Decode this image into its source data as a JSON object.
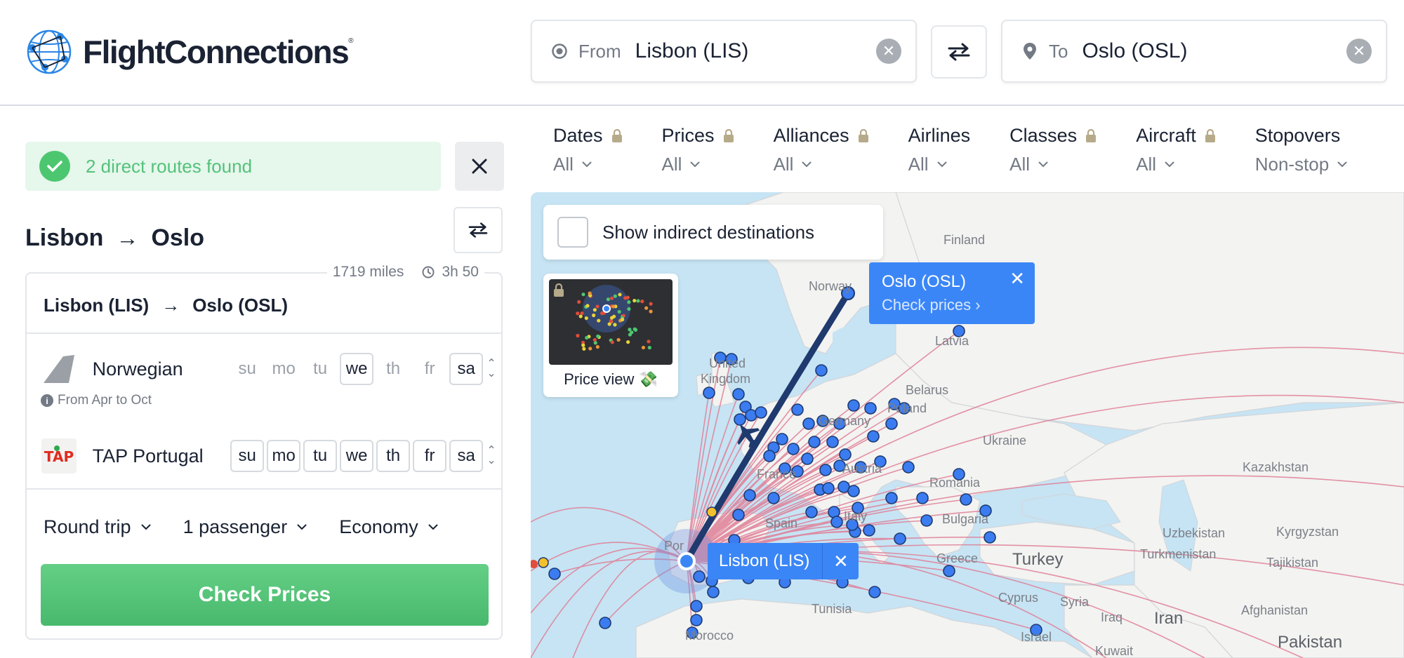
{
  "brand": {
    "name": "FlightConnections",
    "mark": "®"
  },
  "search": {
    "from_label": "From",
    "from_value": "Lisbon (LIS)",
    "to_label": "To",
    "to_value": "Oslo (OSL)"
  },
  "status": {
    "text": "2 direct routes found"
  },
  "route": {
    "from": "Lisbon",
    "to": "Oslo",
    "arrow": "→"
  },
  "card": {
    "distance": "1719 miles",
    "duration": "3h 50",
    "from": "Lisbon (LIS)",
    "to": "Oslo (OSL)",
    "airlines": [
      {
        "name": "Norwegian",
        "note": "From Apr to Oct",
        "days": [
          {
            "d": "su",
            "on": false
          },
          {
            "d": "mo",
            "on": false
          },
          {
            "d": "tu",
            "on": false
          },
          {
            "d": "we",
            "on": true
          },
          {
            "d": "th",
            "on": false
          },
          {
            "d": "fr",
            "on": false
          },
          {
            "d": "sa",
            "on": true
          }
        ]
      },
      {
        "name": "TAP Portugal",
        "days": [
          {
            "d": "su",
            "on": true
          },
          {
            "d": "mo",
            "on": true
          },
          {
            "d": "tu",
            "on": true
          },
          {
            "d": "we",
            "on": true
          },
          {
            "d": "th",
            "on": true
          },
          {
            "d": "fr",
            "on": true
          },
          {
            "d": "sa",
            "on": true
          }
        ]
      }
    ],
    "trip_type": "Round trip",
    "passengers": "1 passenger",
    "cabin": "Economy",
    "cta": "Check Prices"
  },
  "filters": [
    {
      "label": "Dates",
      "value": "All",
      "locked": true
    },
    {
      "label": "Prices",
      "value": "All",
      "locked": true
    },
    {
      "label": "Alliances",
      "value": "All",
      "locked": true
    },
    {
      "label": "Airlines",
      "value": "All",
      "locked": false
    },
    {
      "label": "Classes",
      "value": "All",
      "locked": true
    },
    {
      "label": "Aircraft",
      "value": "All",
      "locked": true
    },
    {
      "label": "Stopovers",
      "value": "Non-stop",
      "locked": false
    }
  ],
  "map": {
    "indirect_label": "Show indirect destinations",
    "price_view_label": "Price view 💸",
    "popup_title": "Oslo (OSL)",
    "popup_link": "Check prices ›",
    "origin_label": "Lisbon (LIS)",
    "labels": {
      "finland": "Finland",
      "norway": "Norway",
      "latvia": "Latvia",
      "uk1": "United",
      "uk2": "Kingdom",
      "belarus": "Belarus",
      "germany": "Germany",
      "poland": "Poland",
      "ukraine": "Ukraine",
      "kazakhstan": "Kazakhstan",
      "austria": "Austria",
      "france": "France",
      "romania": "Romania",
      "italy": "Italy",
      "bulgaria": "Bulgaria",
      "uzbekistan": "Uzbekistan",
      "kyrgyzstan": "Kyrgyzstan",
      "turkmenistan": "Turkmenistan",
      "tajikistan": "Tajikistan",
      "greece": "Greece",
      "turkey": "Turkey",
      "tunisia": "Tunisia",
      "cyprus": "Cyprus",
      "syria": "Syria",
      "iraq": "Iraq",
      "iran": "Iran",
      "afghanistan": "Afghanistan",
      "morocco": "Morocco",
      "israel": "Israel",
      "kuwait": "Kuwait",
      "pakistan": "Pakistan",
      "spain": "Spain",
      "portugal": "Por"
    },
    "colors": {
      "route": "#1e3a6e",
      "lines": "#e07f97",
      "dot": "#3b7cf0",
      "water": "#c6e4f4",
      "land": "#f3f3f1"
    }
  }
}
